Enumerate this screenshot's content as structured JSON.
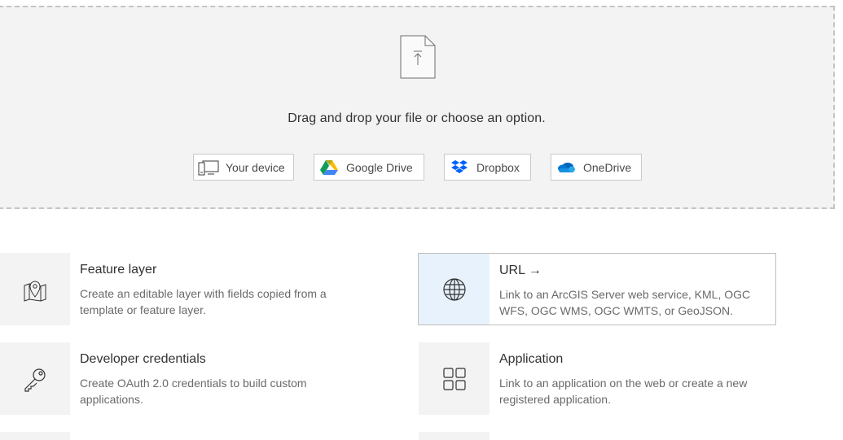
{
  "upload": {
    "prompt": "Drag and drop your file or choose an option.",
    "options": [
      {
        "label": "Your device",
        "icon": "device-icon"
      },
      {
        "label": "Google Drive",
        "icon": "google-drive-icon"
      },
      {
        "label": "Dropbox",
        "icon": "dropbox-icon"
      },
      {
        "label": "OneDrive",
        "icon": "onedrive-icon"
      }
    ]
  },
  "items": [
    {
      "title": "Feature layer",
      "desc": "Create an editable layer with fields copied from a template or feature layer.",
      "icon": "map-pin-icon"
    },
    {
      "title": "URL →",
      "desc": "Link to an ArcGIS Server web service, KML, OGC WFS, OGC WMS, OGC WMTS, or GeoJSON.",
      "icon": "globe-icon"
    },
    {
      "title": "Developer credentials",
      "desc": "Create OAuth 2.0 credentials to build custom applications.",
      "icon": "key-icon"
    },
    {
      "title": "Application",
      "desc": "Link to an application on the web or create a new registered application.",
      "icon": "grid-icon"
    }
  ],
  "colors": {
    "selected_bg": "#e8f2fc",
    "google_blue": "#4285f4",
    "dropbox_blue": "#0061fe",
    "onedrive_blue": "#0f6fd8"
  }
}
